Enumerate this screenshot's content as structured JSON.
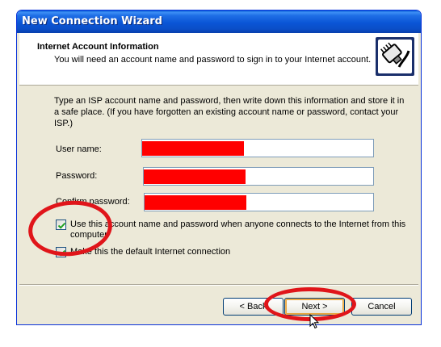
{
  "window": {
    "title": "New Connection Wizard"
  },
  "header": {
    "title": "Internet Account Information",
    "subtitle": "You will need an account name and password to sign in to your Internet account."
  },
  "intro_text": "Type an ISP account name and password, then write down this information and store it in a safe place. (If you have forgotten an existing account name or password, contact your ISP.)",
  "fields": {
    "username_label": "User name:",
    "password_label": "Password:",
    "confirm_label": "Confirm password:"
  },
  "checkboxes": {
    "use_for_all": {
      "label": "Use this account name and password when anyone connects to the Internet from this computer",
      "checked": true
    },
    "default_connection": {
      "label": "Make this the default Internet connection",
      "checked": true
    }
  },
  "buttons": {
    "back": "< Back",
    "next": "Next >",
    "cancel": "Cancel"
  },
  "colors": {
    "redaction": "#ff0000",
    "annotation": "#e0151a",
    "titlebar": "#0a55d6",
    "face": "#ece9d8"
  }
}
